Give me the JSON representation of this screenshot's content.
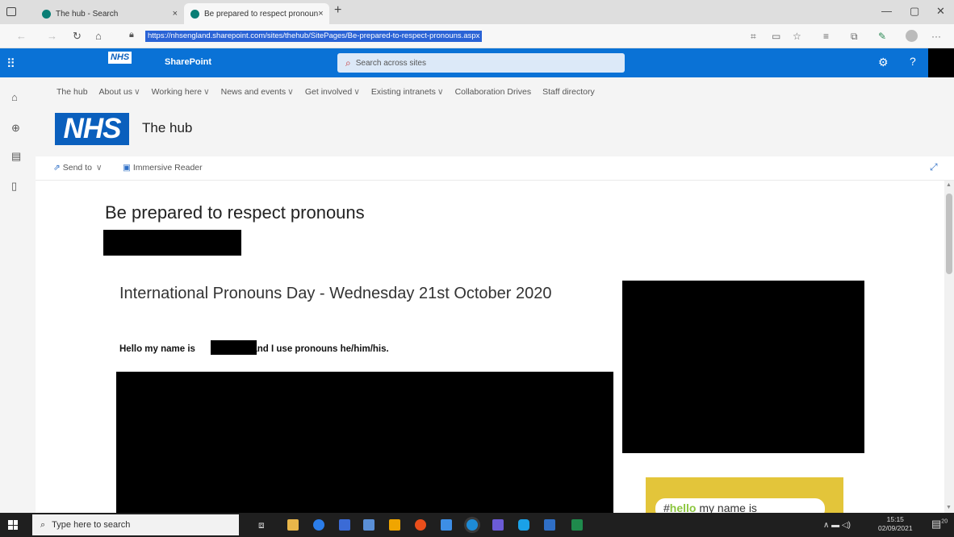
{
  "browser": {
    "tabs": [
      {
        "label": "The hub - Search",
        "close": "×"
      },
      {
        "label": "Be prepared to respect pronoun",
        "close": "×"
      }
    ],
    "new_tab": "+",
    "url": "https://nhsengland.sharepoint.com/sites/thehub/SitePages/Be-prepared-to-respect-pronouns.aspx",
    "window_controls": {
      "min": "—",
      "max": "▢",
      "close": "✕"
    },
    "toolbar_more": "···"
  },
  "suite": {
    "brand_badge": "NHS",
    "app_name": "SharePoint",
    "search_placeholder": "Search across sites",
    "help": "?"
  },
  "hub_nav": {
    "items": [
      {
        "label": "The hub",
        "dropdown": false
      },
      {
        "label": "About us",
        "dropdown": true
      },
      {
        "label": "Working here",
        "dropdown": true
      },
      {
        "label": "News and events",
        "dropdown": true
      },
      {
        "label": "Get involved",
        "dropdown": true
      },
      {
        "label": "Existing intranets",
        "dropdown": true
      },
      {
        "label": "Collaboration Drives",
        "dropdown": false
      },
      {
        "label": "Staff directory",
        "dropdown": false
      }
    ]
  },
  "site": {
    "logo": "NHS",
    "title": "The hub"
  },
  "commands": {
    "send_to": "Send to",
    "immersive_reader": "Immersive Reader"
  },
  "article": {
    "title": "Be prepared to respect pronouns",
    "subheading": "International Pronouns Day - Wednesday 21st October 2020",
    "hello_prefix": "Hello my name is",
    "hello_suffix": "and I use pronouns he/him/his.",
    "card_hash": "#",
    "card_hello": "hello",
    "card_rest": "my name is"
  },
  "taskbar": {
    "search_placeholder": "Type here to search",
    "time": "15:15",
    "date": "02/09/2021",
    "notifications": "20"
  },
  "colors": {
    "suite_bar": "#0a72d6",
    "nhs_blue": "#0a5fbd",
    "url_highlight": "#2a63d6",
    "card_yellow": "#e3c53a",
    "hello_green": "#8cc63f"
  }
}
